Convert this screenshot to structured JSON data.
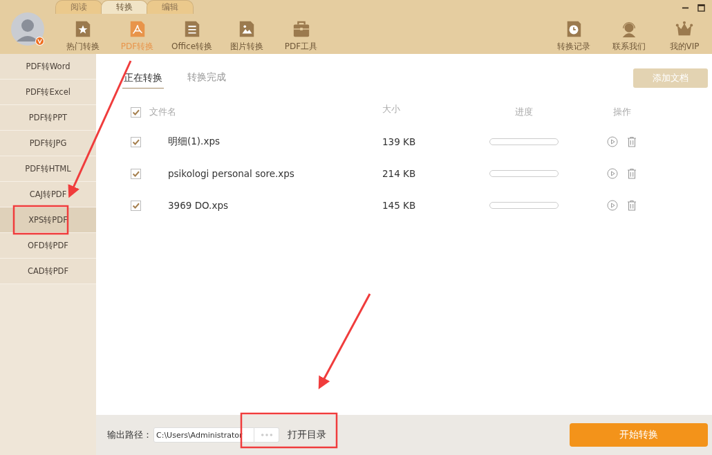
{
  "mode_tabs": [
    {
      "label": "阅读",
      "selected": false
    },
    {
      "label": "转换",
      "selected": true
    },
    {
      "label": "编辑",
      "selected": false
    }
  ],
  "toolbar": [
    {
      "label": "热门转换",
      "kind": "star",
      "selected": false
    },
    {
      "label": "PDF转换",
      "kind": "pdf",
      "selected": true
    },
    {
      "label": "Office转换",
      "kind": "doc",
      "selected": false
    },
    {
      "label": "图片转换",
      "kind": "image",
      "selected": false
    },
    {
      "label": "PDF工具",
      "kind": "toolbox",
      "selected": false
    }
  ],
  "right_tools": [
    {
      "label": "转换记录",
      "kind": "clock"
    },
    {
      "label": "联系我们",
      "kind": "headset"
    },
    {
      "label": "我的VIP",
      "kind": "crown"
    }
  ],
  "sidebar": {
    "items": [
      {
        "label": "PDF转Word",
        "selected": false
      },
      {
        "label": "PDF转Excel",
        "selected": false
      },
      {
        "label": "PDF转PPT",
        "selected": false
      },
      {
        "label": "PDF转JPG",
        "selected": false
      },
      {
        "label": "PDF转HTML",
        "selected": false
      },
      {
        "label": "CAJ转PDF",
        "selected": false
      },
      {
        "label": "XPS转PDF",
        "selected": true
      },
      {
        "label": "OFD转PDF",
        "selected": false
      },
      {
        "label": "CAD转PDF",
        "selected": false
      }
    ]
  },
  "tabs": [
    {
      "label": "正在转换",
      "selected": true
    },
    {
      "label": "转换完成",
      "selected": false
    }
  ],
  "add_button": "添加文档",
  "table": {
    "all_checked": true,
    "columns": [
      "文件名",
      "大小",
      "进度",
      "操作"
    ],
    "rows": [
      {
        "checked": true,
        "name": "明细(1).xps",
        "size": "139 KB",
        "level": 0
      },
      {
        "checked": true,
        "name": "psikologi personal sore.xps",
        "size": "214 KB",
        "level": 0
      },
      {
        "checked": true,
        "name": "3969 DO.xps",
        "size": "145 KB",
        "level": 0
      }
    ]
  },
  "footer": {
    "label": "输出路径：",
    "path": "C:\\Users\\Administrator",
    "open_folder": "打开目录",
    "start_button": "开始转换"
  }
}
